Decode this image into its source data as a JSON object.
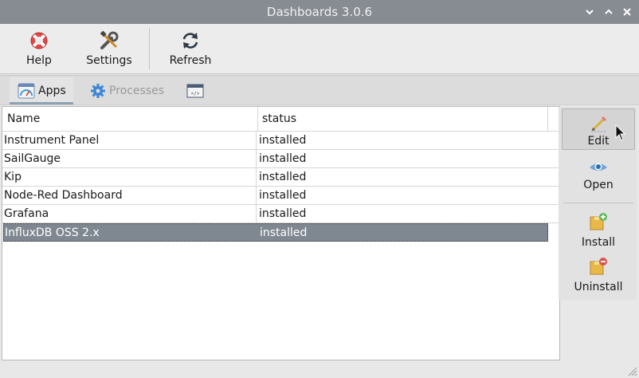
{
  "window": {
    "title": "Dashboards 3.0.6"
  },
  "toolbar": {
    "help_label": "Help",
    "settings_label": "Settings",
    "refresh_label": "Refresh"
  },
  "tabs": [
    {
      "label": "Apps",
      "icon": "dashboard-gauge-icon",
      "active": true
    },
    {
      "label": "Processes",
      "icon": "gear-icon",
      "active": false
    },
    {
      "label": "",
      "icon": "code-window-icon",
      "active": false
    }
  ],
  "table": {
    "columns": [
      "Name",
      "status"
    ],
    "rows": [
      {
        "name": "Instrument Panel",
        "status": "installed"
      },
      {
        "name": "SailGauge",
        "status": "installed"
      },
      {
        "name": "Kip",
        "status": "installed"
      },
      {
        "name": "Node-Red Dashboard",
        "status": "installed"
      },
      {
        "name": "Grafana",
        "status": "installed"
      },
      {
        "name": "InfluxDB OSS 2.x",
        "status": "installed",
        "selected": true
      }
    ]
  },
  "actions": {
    "edit_label": "Edit",
    "open_label": "Open",
    "install_label": "Install",
    "uninstall_label": "Uninstall"
  },
  "colors": {
    "titlebar": "#878c93",
    "selection": "#7f8890",
    "tab_underline": "#8ea2b1",
    "refresh_icon": "#2e3a44",
    "eye_icon": "#3d7fc1"
  }
}
